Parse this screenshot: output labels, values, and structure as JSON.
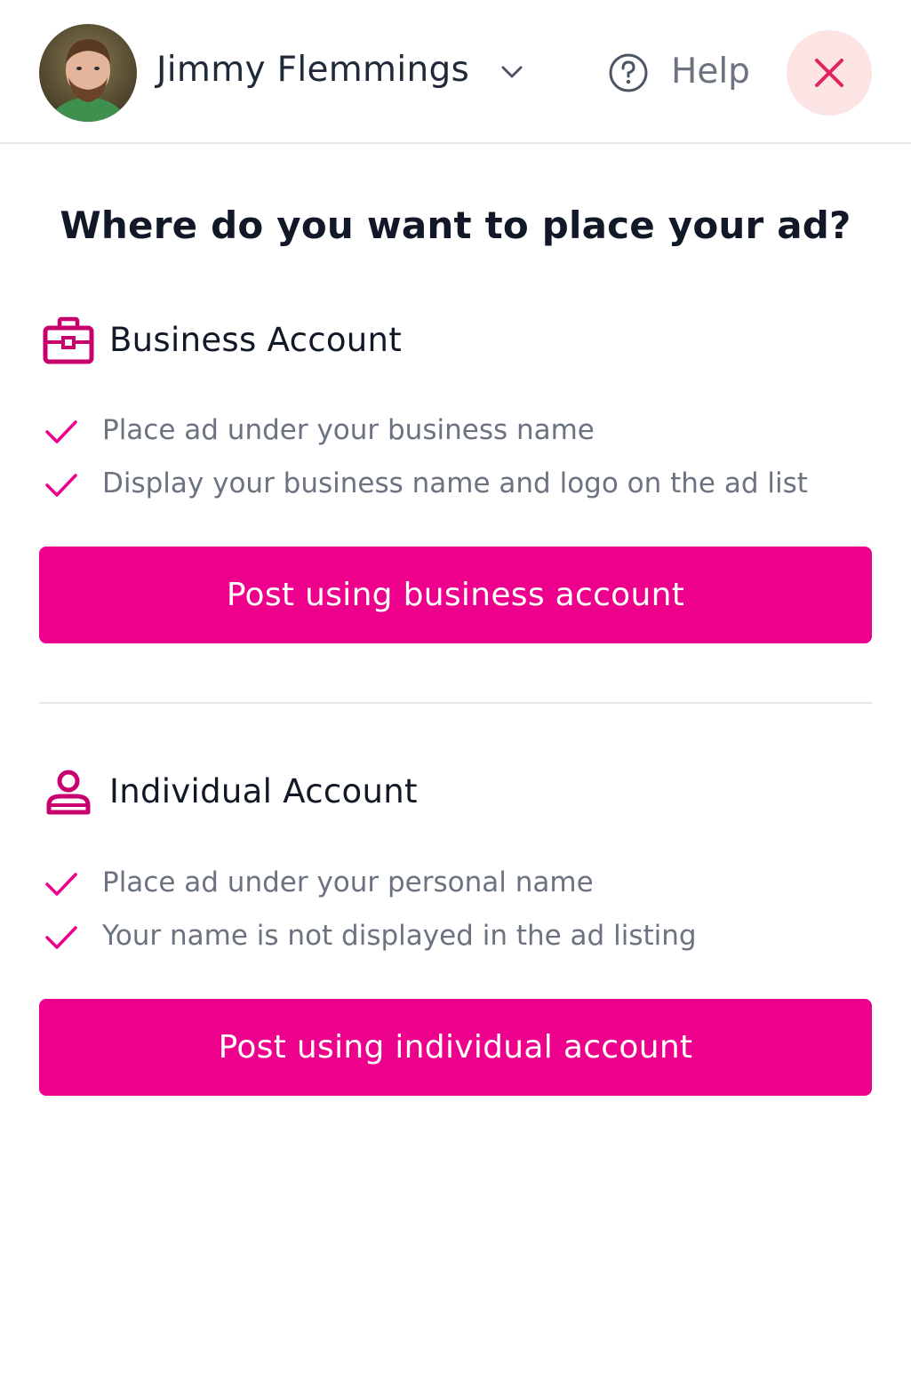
{
  "header": {
    "user_name": "Jimmy Flemmings",
    "help_label": "Help",
    "icons": {
      "dropdown": "chevron-down-icon",
      "help": "question-circle-icon",
      "close": "close-icon"
    }
  },
  "title": "Where do you want to place your ad?",
  "business": {
    "title": "Business Account",
    "icon": "briefcase-icon",
    "features": [
      "Place ad under your business name",
      "Display your business name and logo on the ad list"
    ],
    "button_label": "Post using business account"
  },
  "individual": {
    "title": "Individual Account",
    "icon": "user-icon",
    "features": [
      "Place ad under your personal name",
      "Your name is not displayed in the ad listing"
    ],
    "button_label": "Post using individual account"
  },
  "colors": {
    "accent": "#ec008c",
    "icon_accent": "#c8006e",
    "close_bg": "#fde4e4",
    "close_x": "#e0245e",
    "muted_text": "#6b7280"
  }
}
